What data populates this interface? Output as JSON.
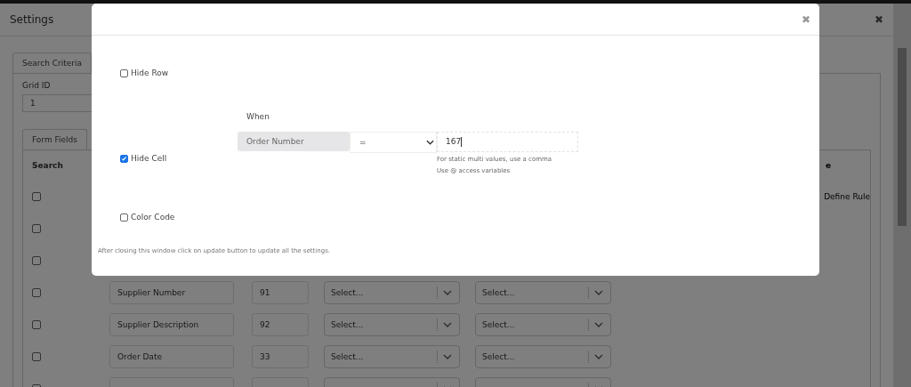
{
  "window": {
    "title": "Settings",
    "close": "✖"
  },
  "tabs": [
    {
      "label": "Search Criteria",
      "selected": true
    }
  ],
  "grid_id": {
    "label": "Grid ID",
    "value": "1"
  },
  "inner_tabs": [
    {
      "label": "Form Fields",
      "selected": true
    }
  ],
  "table": {
    "columns": [
      "Search",
      "e"
    ],
    "rows": [
      {
        "checked": false,
        "rule": "Define Rule"
      },
      {
        "checked": false
      },
      {
        "checked": false
      },
      {
        "checked": false,
        "field": "Supplier Number",
        "number": "91",
        "select_1": "Select...",
        "select_2": "Select..."
      },
      {
        "checked": false,
        "field": "Supplier Description",
        "number": "92",
        "select_1": "Select...",
        "select_2": "Select..."
      },
      {
        "checked": false,
        "field": "Order Date",
        "number": "33",
        "select_1": "Select...",
        "select_2": "Select..."
      },
      {
        "checked": false,
        "field": "",
        "number": "",
        "select_1": "",
        "select_2": ""
      }
    ]
  },
  "modal": {
    "close": "✖",
    "options": [
      {
        "kind": "plain",
        "label": "Hide Row",
        "checked": false
      },
      {
        "kind": "condition",
        "label": "Hide Cell",
        "checked": true,
        "when": "When",
        "field": "Order Number",
        "operator": "=",
        "value": "167",
        "hints": [
          "For static multi values, use a comma",
          "Use @ access variables"
        ]
      },
      {
        "kind": "plain",
        "label": "Color Code",
        "checked": false
      }
    ],
    "note": "After closing this window click on update button to update all the settings."
  }
}
